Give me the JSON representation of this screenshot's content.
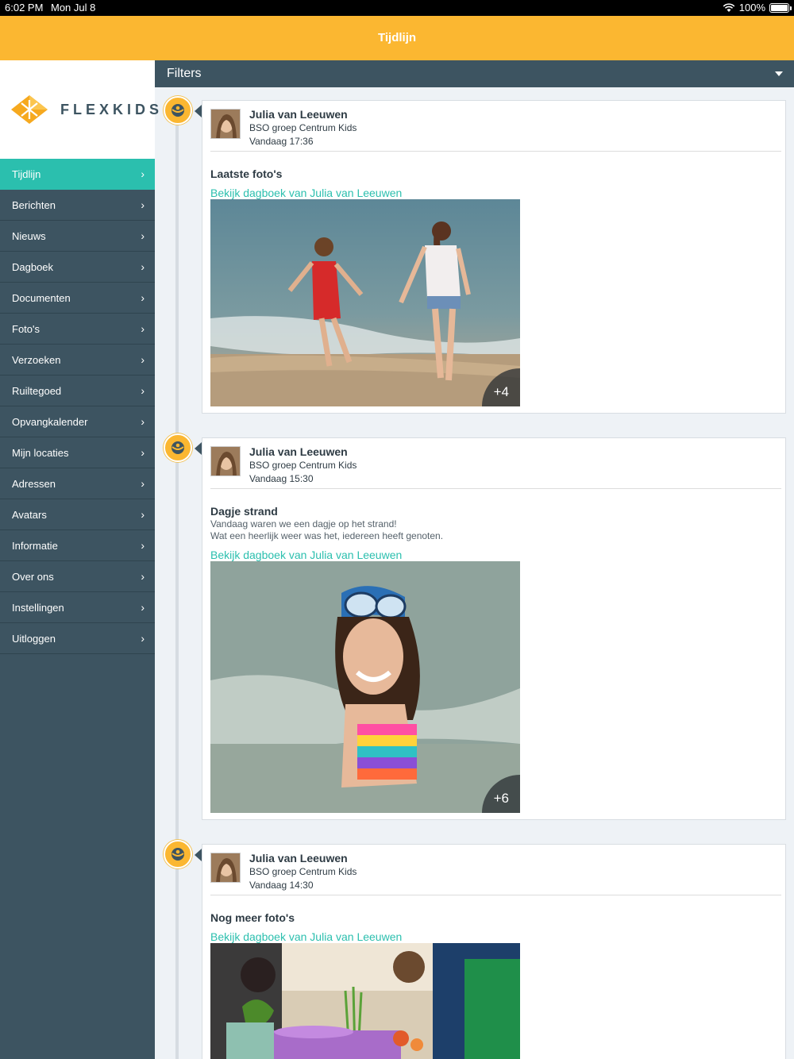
{
  "status_bar": {
    "time": "6:02 PM",
    "date": "Mon Jul 8",
    "battery": "100%"
  },
  "header": {
    "title": "Tijdlijn"
  },
  "logo": {
    "text": "FLEXKIDS"
  },
  "filters": {
    "label": "Filters"
  },
  "sidebar": {
    "items": [
      {
        "label": "Tijdlijn",
        "active": true
      },
      {
        "label": "Berichten"
      },
      {
        "label": "Nieuws"
      },
      {
        "label": "Dagboek"
      },
      {
        "label": "Documenten"
      },
      {
        "label": "Foto's"
      },
      {
        "label": "Verzoeken"
      },
      {
        "label": "Ruiltegoed"
      },
      {
        "label": "Opvangkalender"
      },
      {
        "label": "Mijn locaties"
      },
      {
        "label": "Adressen"
      },
      {
        "label": "Avatars"
      },
      {
        "label": "Informatie"
      },
      {
        "label": "Over ons"
      },
      {
        "label": "Instellingen"
      },
      {
        "label": "Uitloggen"
      }
    ]
  },
  "posts": [
    {
      "author": "Julia van Leeuwen",
      "group": "BSO groep Centrum Kids",
      "time": "Vandaag 17:36",
      "title": "Laatste foto's",
      "link": "Bekijk dagboek van Julia van Leeuwen",
      "more": "+4"
    },
    {
      "author": "Julia van Leeuwen",
      "group": "BSO groep Centrum Kids",
      "time": "Vandaag 15:30",
      "title": "Dagje strand",
      "body_line1": "Vandaag waren we een dagje op het strand!",
      "body_line2": "Wat een heerlijk weer was het, iedereen heeft genoten.",
      "link": "Bekijk dagboek van Julia van Leeuwen",
      "more": "+6"
    },
    {
      "author": "Julia van Leeuwen",
      "group": "BSO groep Centrum Kids",
      "time": "Vandaag 14:30",
      "title": "Nog meer foto's",
      "link": "Bekijk dagboek van Julia van Leeuwen"
    }
  ],
  "colors": {
    "accent": "#fbb731",
    "teal": "#2bbfae",
    "navy": "#3d5461"
  }
}
